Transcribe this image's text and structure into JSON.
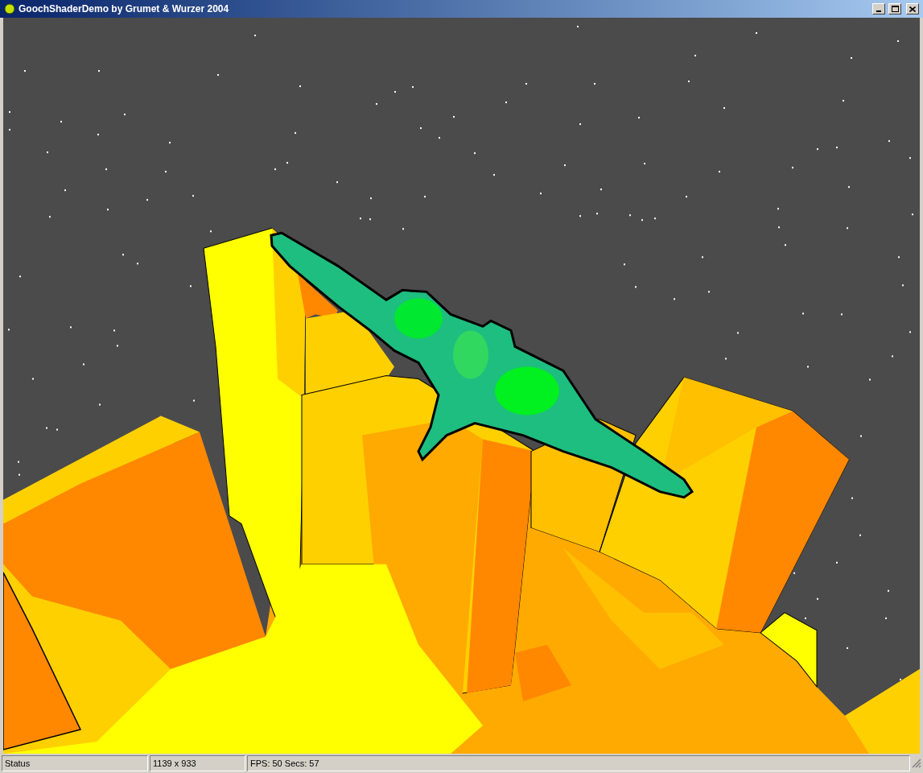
{
  "window": {
    "title": "GoochShaderDemo by Grumet & Wurzer 2004"
  },
  "status_bar": [
    {
      "text": "Status"
    },
    {
      "text": "1139 x 933"
    },
    {
      "text": "FPS: 50 Secs: 57"
    }
  ]
}
